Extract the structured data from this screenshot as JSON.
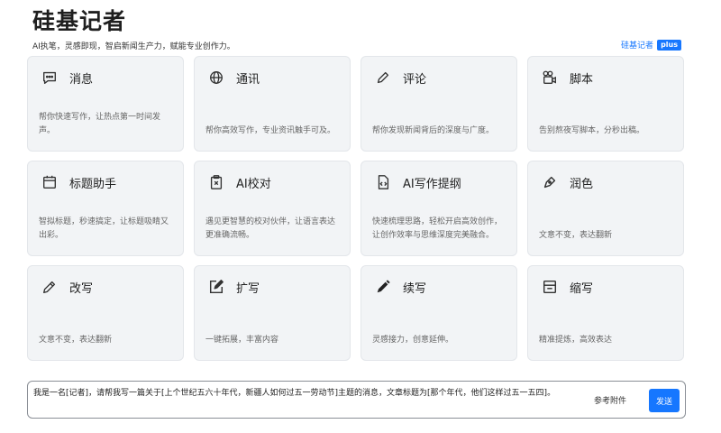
{
  "header": {
    "title": "硅基记者",
    "subtitle": "AI执笔，灵感即现，智启新闻生产力，赋能专业创作力。",
    "brand_link": "硅基记者",
    "brand_badge": "plus"
  },
  "cards": [
    {
      "title": "消息",
      "desc": "帮你快速写作，让热点第一时间发声。",
      "icon": "message-icon"
    },
    {
      "title": "通讯",
      "desc": "帮你高效写作，专业资讯触手可及。",
      "icon": "globe-icon"
    },
    {
      "title": "评论",
      "desc": "帮你发现新闻背后的深度与广度。",
      "icon": "pen-icon"
    },
    {
      "title": "脚本",
      "desc": "告别熬夜写脚本，分秒出稿。",
      "icon": "script-icon"
    },
    {
      "title": "标题助手",
      "desc": "智拟标题，秒速搞定，让标题吸睛又出彩。",
      "icon": "calendar-icon"
    },
    {
      "title": "AI校对",
      "desc": "遇见更智慧的校对伙伴，让语言表达更准确流畅。",
      "icon": "clipboard-icon"
    },
    {
      "title": "AI写作提纲",
      "desc": "快速梳理思路，轻松开启高效创作，让创作效率与思维深度完美融合。",
      "icon": "code-file-icon"
    },
    {
      "title": "润色",
      "desc": "文意不变，表达翻新",
      "icon": "brush-icon"
    },
    {
      "title": "改写",
      "desc": "文意不变，表达翻新",
      "icon": "pencil-icon"
    },
    {
      "title": "扩写",
      "desc": "一键拓展，丰富内容",
      "icon": "edit-box-icon"
    },
    {
      "title": "续写",
      "desc": "灵感接力，创意延伸。",
      "icon": "pencil-solid-icon"
    },
    {
      "title": "缩写",
      "desc": "精准提炼，高效表达",
      "icon": "window-icon"
    }
  ],
  "prompt": {
    "text": "我是一名[记者]，请帮我写一篇关于[上个世纪五六十年代，新疆人如何过五一劳动节]主题的消息，文章标题为[那个年代，他们这样过五一五四]。",
    "attach_label": "参考附件",
    "send_label": "发送"
  },
  "colors": {
    "accent": "#1677ff",
    "card_bg": "#f2f4f6"
  }
}
